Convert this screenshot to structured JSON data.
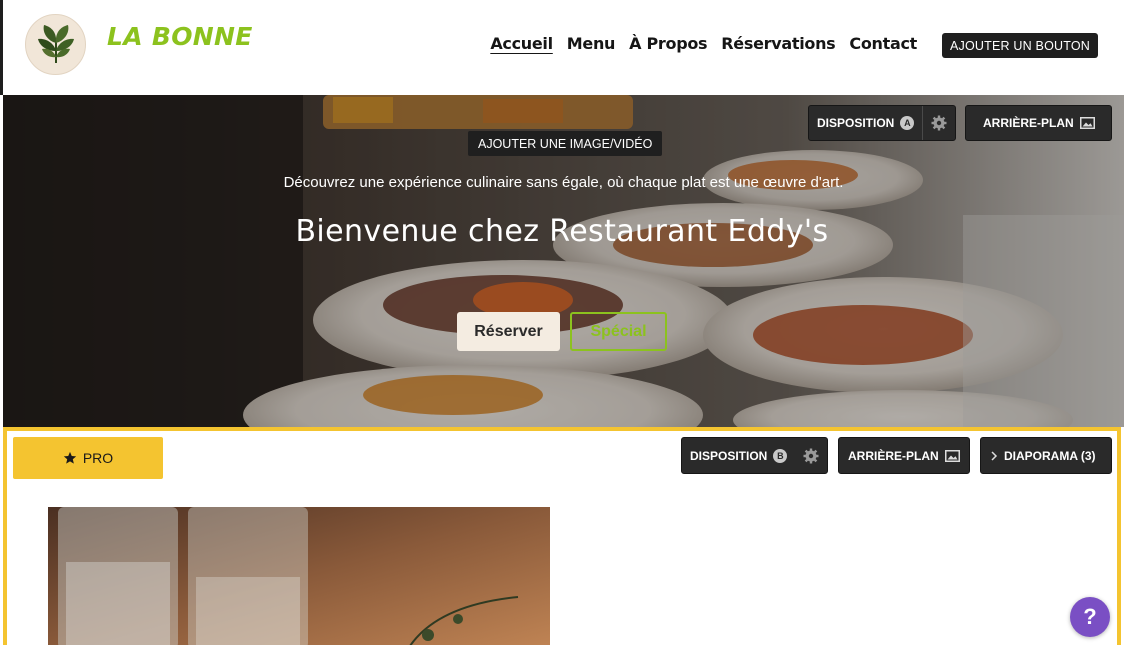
{
  "header": {
    "brand": "LA BONNE",
    "nav": [
      "Accueil",
      "Menu",
      "À Propos",
      "Réservations",
      "Contact"
    ],
    "add_button": "AJOUTER UN BOUTON",
    "logo_icon": "leaf-icon"
  },
  "hero": {
    "disposition_label": "DISPOSITION",
    "disposition_badge": "A",
    "background_label": "ARRIÈRE-PLAN",
    "media_button": "AJOUTER UNE IMAGE/VIDÉO",
    "tagline": "Découvrez une expérience culinaire sans égale, où chaque plat est une œuvre d'art.",
    "title": "Bienvenue chez Restaurant Eddy's",
    "reserve_button": "Réserver",
    "special_button": "Spécial"
  },
  "section2": {
    "pro_label": "PRO",
    "disposition_label": "DISPOSITION",
    "disposition_badge": "B",
    "background_label": "ARRIÈRE-PLAN",
    "slideshow_label": "DIAPORAMA (3)"
  },
  "help": {
    "label": "?"
  },
  "colors": {
    "brand": "#8cc21e",
    "pro_yellow": "#f4c430",
    "help_purple": "#7a4fc4",
    "dark_button": "#2a2a2a"
  }
}
